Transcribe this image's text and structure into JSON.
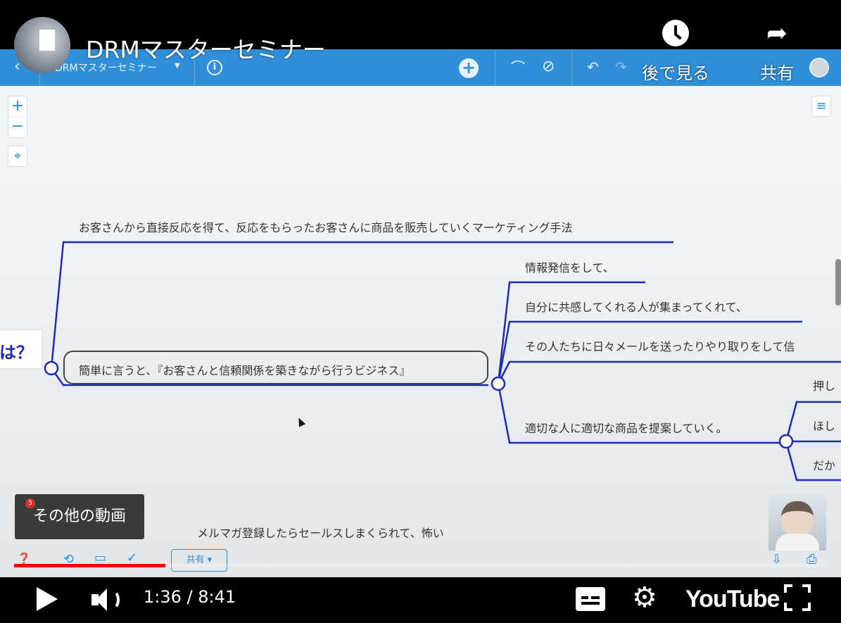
{
  "video": {
    "title": "DRMマスターセミナー",
    "watch_later_label": "後で見る",
    "share_label": "共有",
    "more_videos_label": "その他の動画",
    "time_text": "1:36 / 8:41",
    "progress_fraction": 0.186,
    "logo_text": "YouTube"
  },
  "app": {
    "map_title": "DRMマスターセミナー",
    "share_button": "共有",
    "notification_count": "5"
  },
  "mindmap": {
    "root_label": "は？",
    "main_node": "簡単に言うと、『お客さんと信頼関係を築きながら行うビジネス』",
    "definition": "お客さんから直接反応を得て、反応をもらったお客さんに商品を販売していくマーケティング手法",
    "steps": [
      "情報発信をして、",
      "自分に共感してくれる人が集まってくれて、",
      "その人たちに日々メールを送ったりやり取りをして信",
      "適切な人に適切な商品を提案していく。"
    ],
    "sub_steps": [
      "押し",
      "ほし",
      "だか"
    ],
    "bottom_note": "メルマガ登録したらセールスしまくられて、怖い"
  },
  "colors": {
    "accent": "#2f8fd9",
    "branch": "#1e2ab8",
    "progress": "#ff0000"
  }
}
